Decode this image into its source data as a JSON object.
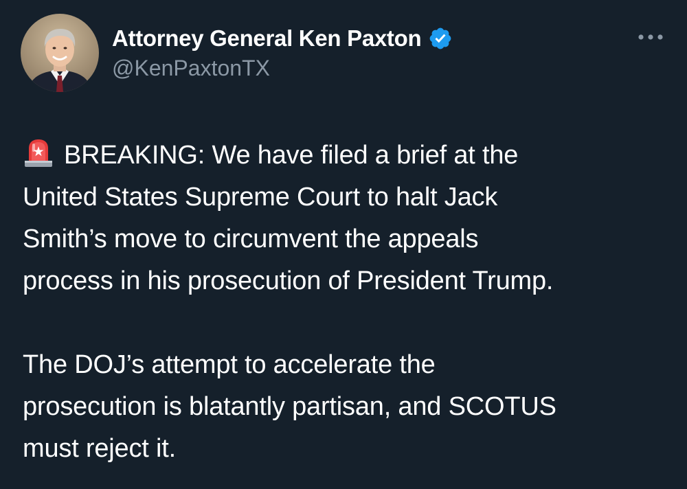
{
  "author": {
    "display_name": "Attorney General Ken Paxton",
    "handle": "@KenPaxtonTX",
    "verified": true,
    "verified_color": "#1d9bf0"
  },
  "more_icon": "more-horizontal-icon",
  "tweet": {
    "emoji": "police-car-light",
    "paragraphs": [
      {
        "lines": [
          "BREAKING: We have filed a brief at the",
          "United States Supreme Court to halt Jack",
          "Smith’s move to circumvent the appeals",
          "process in his prosecution of President Trump."
        ]
      },
      {
        "lines": [
          "The DOJ’s attempt to accelerate the",
          "prosecution is blatantly partisan, and SCOTUS",
          "must reject it."
        ]
      }
    ]
  },
  "colors": {
    "background": "#15202b",
    "text": "#ffffff",
    "secondary_text": "#8b98a5"
  }
}
